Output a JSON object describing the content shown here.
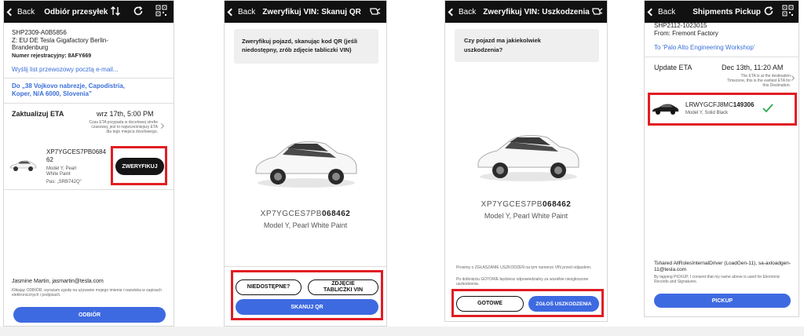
{
  "colors": {
    "accent_blue": "#3e6ae1",
    "red_highlight": "#e01e24",
    "topbar": "#111111",
    "check_green": "#2aa84a"
  },
  "screen1": {
    "back_label": "Back",
    "title": "Odbiór przesyłek",
    "icons": [
      "sort-arrows-icon",
      "refresh-icon",
      "qr-code-icon"
    ],
    "shipment_id": "SHP2309-A0B5856",
    "from_line": "Z: EU DE Tesla Gigafactory Berlin-",
    "from_line2": "Brandenburg",
    "plate_label": "Numer rejestracyjny:",
    "plate_value": "8AFY669",
    "email_link": "Wyślij list przewozowy pocztą e-mail...",
    "dest_line1": "Do „38 Vojkovo nabrezje, Capodistria,",
    "dest_line2": "Koper, N/A 6000, Slovenia”",
    "eta_label": "Zaktualizuj ETA",
    "eta_value": "wrz 17th, 5:00 PM",
    "eta_note": "Czas ETA przypada w docelowej strefie czasowej, jest to najwcześniejszy ETA dla tego miejsca docelowego.",
    "vin_line1": "XP7YGCES7PB0684",
    "vin_line2": "62",
    "model_line1": "Model Y, Pearl",
    "model_line2": "White Paint",
    "pass_label": "Pas: „SRB742Q”",
    "verify_button": "ZWERYFIKUJ",
    "driver": "Jasmine Martin, jasmartin@tesla.com",
    "consent": "Klikając ODBIÓR, wyrażam zgodę na używanie mojego imienia i nazwiska w zapisach elektronicznych i podpisach.",
    "pickup_button": "ODBIÓR"
  },
  "screen2": {
    "back_label": "Back",
    "title": "Zweryfikuj VIN: Skanuj QR",
    "icons": [
      "flashlight-icon"
    ],
    "instruction": "Zweryfikuj pojazd, skanując kod QR (jeśli niedostępny, zrób zdjęcie tabliczki VIN)",
    "vin_prefix": "XP7YGCES7PB",
    "vin_suffix": "068462",
    "model": "Model Y, Pearl White Paint",
    "unavailable_button": "NIEDOSTĘPNE?",
    "photo_button_line1": "ZDJĘCIE",
    "photo_button_line2": "TABLICZKI VIN",
    "scan_button": "SKANUJ QR"
  },
  "screen3": {
    "back_label": "Back",
    "title": "Zweryfikuj VIN: Uszkodzenia",
    "icons": [
      "flashlight-icon"
    ],
    "question": "Czy pojazd ma jakiekolwiek uszkodzenia?",
    "vin_prefix": "XP7YGCES7PB",
    "vin_suffix": "068462",
    "model": "Model Y, Pearl White Paint",
    "note1": "Prosimy o ZGŁASZANIE USZKODZEŃ na tym numerze VIN przed odjazdem.",
    "note2": "Po dotknięciu GOTOWE będziesz odpowiedzialny za wszelkie niezgłoszone uszkodzenia.",
    "done_button": "GOTOWE",
    "report_button": "ZGŁOŚ USZKODZENIA"
  },
  "screen4": {
    "back_label": "Back",
    "title": "Shipments Pickup",
    "icons": [
      "refresh-icon",
      "qr-code-icon"
    ],
    "shipment_id": "SHP2112-1023015",
    "from_line": "From: Fremont Factory",
    "dest_link": "To 'Palo Alto Engineering Workshop'",
    "eta_label": "Update ETA",
    "eta_value": "Dec 13th, 11:20 AM",
    "eta_note": "The ETA is at the destination Timezone, this is the earliest ETA for this Destination.",
    "vin_prefix": "LRWYGCFJ8MC",
    "vin_suffix": "149306",
    "model": "Model Y, Solid Black",
    "driver": "Tshared AllRolesInternalDriver (LoadGen-11), sa-axloadgen-11@tesla.com",
    "consent": "By tapping PICKUP, I consent that my name above is used for Electronic Records and Signatures.",
    "pickup_button": "PICKUP"
  }
}
